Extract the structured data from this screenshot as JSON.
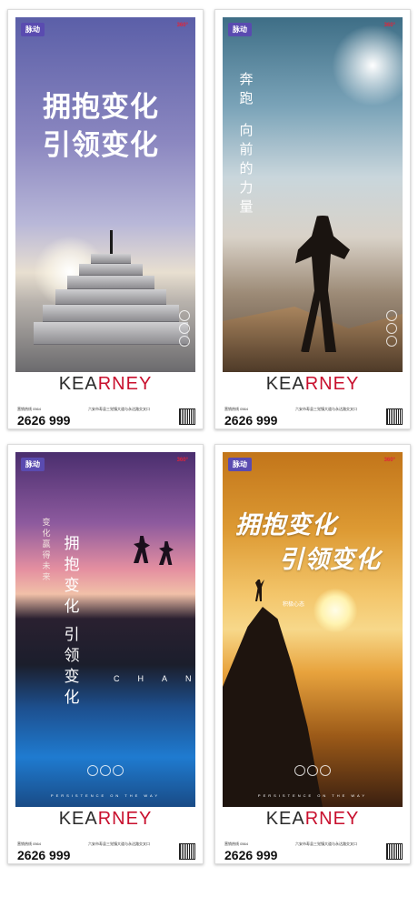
{
  "posters": [
    {
      "badge": "脉动",
      "brand": "360°",
      "headline_lines": [
        "拥抱变化",
        "引领变化"
      ],
      "logo_left": "KEA",
      "logo_right": "RNEY",
      "phone_label": "营销热线 0564",
      "phone": "2626 999",
      "address": "六安市寿县三觉镇大道与永达路交叉口"
    },
    {
      "badge": "脉动",
      "brand": "360°",
      "vertical_text": [
        "奔",
        "跑",
        "",
        "向",
        "前",
        "的",
        "力",
        "量"
      ],
      "logo_left": "KEA",
      "logo_right": "RNEY",
      "phone_label": "营销热线 0564",
      "phone": "2626 999",
      "address": "六安市寿县三觉镇大道与永达路交叉口"
    },
    {
      "badge": "脉动",
      "brand": "360°",
      "vertical_small": [
        "变",
        "化",
        "赢",
        "得",
        "未",
        "来"
      ],
      "vertical_big": [
        "拥",
        "抱",
        "变",
        "化",
        "",
        "引",
        "领",
        "变",
        "化"
      ],
      "english": "CHAN",
      "tagline": "PERSISTENCE ON THE WAY",
      "logo_left": "KEA",
      "logo_right": "RNEY",
      "phone_label": "营销热线 0564",
      "phone": "2626 999",
      "address": "六安市寿县三觉镇大道与永达路交叉口"
    },
    {
      "badge": "脉动",
      "brand": "360°",
      "headline_lines": [
        "拥抱变化",
        "引领变化"
      ],
      "subline": "积极心态",
      "tagline": "PERSISTENCE ON THE WAY",
      "logo_left": "KEA",
      "logo_right": "RNEY",
      "phone_label": "营销热线 0564",
      "phone": "2626 999",
      "address": "六安市寿县三觉镇大道与永达路交叉口"
    }
  ],
  "colors": {
    "logo_accent": "#c8102e",
    "badge": "#5a4bb0"
  },
  "icons": [
    "qr-code-icon"
  ]
}
